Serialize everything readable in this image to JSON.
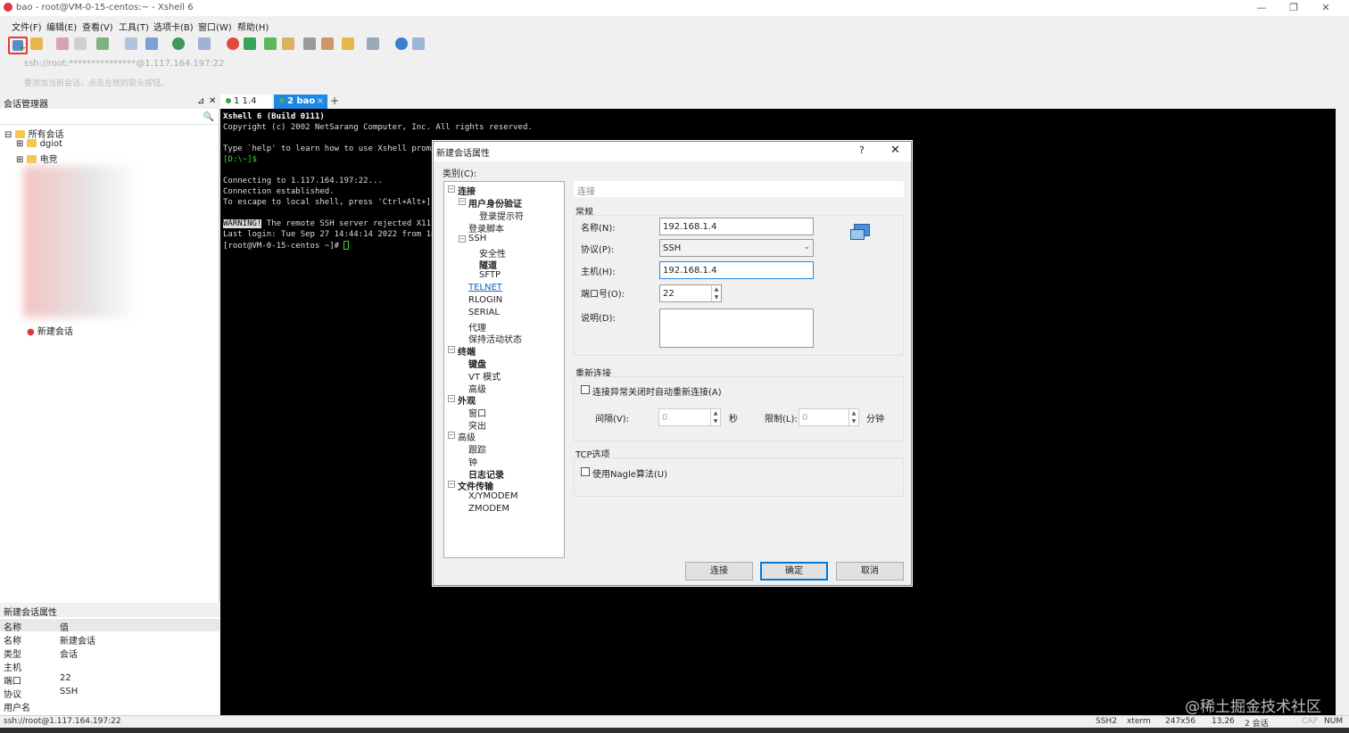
{
  "window": {
    "title": "bao - root@VM-0-15-centos:~ - Xshell 6",
    "minimize": "—",
    "restore": "❐",
    "close": "✕"
  },
  "menu": [
    "文件(F)",
    "编辑(E)",
    "查看(V)",
    "工具(T)",
    "选项卡(B)",
    "窗口(W)",
    "帮助(H)"
  ],
  "address": "ssh://root:***************@1.117.164.197:22",
  "hint": "要添加当前会话，点击左侧的箭头按钮。",
  "session_manager": {
    "title": "会话管理器",
    "pin": "⊿",
    "close": "✕",
    "search_icon": "🔍",
    "tree": {
      "root": "所有会话",
      "folders": [
        "dgiot",
        "电竞"
      ],
      "new_session": "新建会话"
    }
  },
  "properties": {
    "title": "新建会话属性",
    "header_name": "名称",
    "header_value": "值",
    "rows": [
      {
        "k": "名称",
        "v": "新建会话"
      },
      {
        "k": "类型",
        "v": "会话"
      },
      {
        "k": "主机",
        "v": ""
      },
      {
        "k": "端口",
        "v": "22"
      },
      {
        "k": "协议",
        "v": "SSH"
      },
      {
        "k": "用户名",
        "v": ""
      }
    ]
  },
  "tabs": {
    "tab1": "1 1.4",
    "tab2": "2 bao",
    "tab2_close": "×",
    "add": "+"
  },
  "terminal": {
    "lines": [
      "Xshell 6 (Build 0111)",
      "Copyright (c) 2002 NetSarang Computer, Inc. All rights reserved.",
      "Type `help' to learn how to use Xshell prompt.",
      "[D:\\~]$",
      "Connecting to 1.117.164.197:22...",
      "Connection established.",
      "To escape to local shell, press 'Ctrl+Alt+]'.",
      "WARNING!",
      " The remote SSH server rejected X11 for",
      "Last login: Tue Sep 27 14:44:14 2022 from 183.1",
      "[root@VM-0-15-centos ~]# "
    ]
  },
  "dialog": {
    "title": "新建会话属性",
    "help": "?",
    "close": "✕",
    "category_label": "类别(C):",
    "tree": [
      {
        "label": "连接",
        "level": 0,
        "bold": true,
        "exp": "⊟"
      },
      {
        "label": "用户身份验证",
        "level": 1,
        "bold": true,
        "exp": "⊟"
      },
      {
        "label": "登录提示符",
        "level": 2
      },
      {
        "label": "登录脚本",
        "level": 1
      },
      {
        "label": "SSH",
        "level": 1,
        "exp": "⊟"
      },
      {
        "label": "安全性",
        "level": 2
      },
      {
        "label": "隧道",
        "level": 2,
        "bold": true
      },
      {
        "label": "SFTP",
        "level": 2
      },
      {
        "label": "TELNET",
        "level": 1,
        "link": true
      },
      {
        "label": "RLOGIN",
        "level": 1
      },
      {
        "label": "SERIAL",
        "level": 1
      },
      {
        "label": "代理",
        "level": 1
      },
      {
        "label": "保持活动状态",
        "level": 1
      },
      {
        "label": "终端",
        "level": 0,
        "bold": true,
        "exp": "⊟"
      },
      {
        "label": "键盘",
        "level": 1,
        "bold": true
      },
      {
        "label": "VT 模式",
        "level": 1
      },
      {
        "label": "高级",
        "level": 1
      },
      {
        "label": "外观",
        "level": 0,
        "bold": true,
        "exp": "⊟"
      },
      {
        "label": "窗口",
        "level": 1
      },
      {
        "label": "突出",
        "level": 1
      },
      {
        "label": "高级",
        "level": 0,
        "exp": "⊟"
      },
      {
        "label": "跟踪",
        "level": 1
      },
      {
        "label": "钟",
        "level": 1
      },
      {
        "label": "日志记录",
        "level": 1,
        "bold": true
      },
      {
        "label": "文件传输",
        "level": 0,
        "bold": true,
        "exp": "⊟"
      },
      {
        "label": "X/YMODEM",
        "level": 1
      },
      {
        "label": "ZMODEM",
        "level": 1
      }
    ],
    "section": "连接",
    "general": {
      "title": "常规",
      "name_label": "名称(N):",
      "name_value": "192.168.1.4",
      "protocol_label": "协议(P):",
      "protocol_value": "SSH",
      "host_label": "主机(H):",
      "host_value": "192.168.1.4",
      "port_label": "端口号(O):",
      "port_value": "22",
      "desc_label": "说明(D):",
      "desc_value": ""
    },
    "reconnect": {
      "title": "重新连接",
      "checkbox": "连接异常关闭时自动重新连接(A)",
      "interval_label": "间隔(V):",
      "interval_value": "0",
      "interval_unit": "秒",
      "limit_label": "限制(L):",
      "limit_value": "0",
      "limit_unit": "分钟"
    },
    "tcp": {
      "title": "TCP选项",
      "checkbox": "使用Nagle算法(U)"
    },
    "buttons": {
      "connect": "连接",
      "ok": "确定",
      "cancel": "取消"
    }
  },
  "status": {
    "left": "ssh://root@1.117.164.197:22",
    "ssh": "SSH2",
    "term": "xterm",
    "size": "247x56",
    "pos": "13,26",
    "sessions": "2 会话",
    "cap": "CAP",
    "num": "NUM"
  },
  "watermark": "@稀土掘金技术社区",
  "colors": {
    "accent": "#1e88e5",
    "highlight_red": "#e53935",
    "terminal_bg": "#000000",
    "prompt_green": "#37d637"
  }
}
